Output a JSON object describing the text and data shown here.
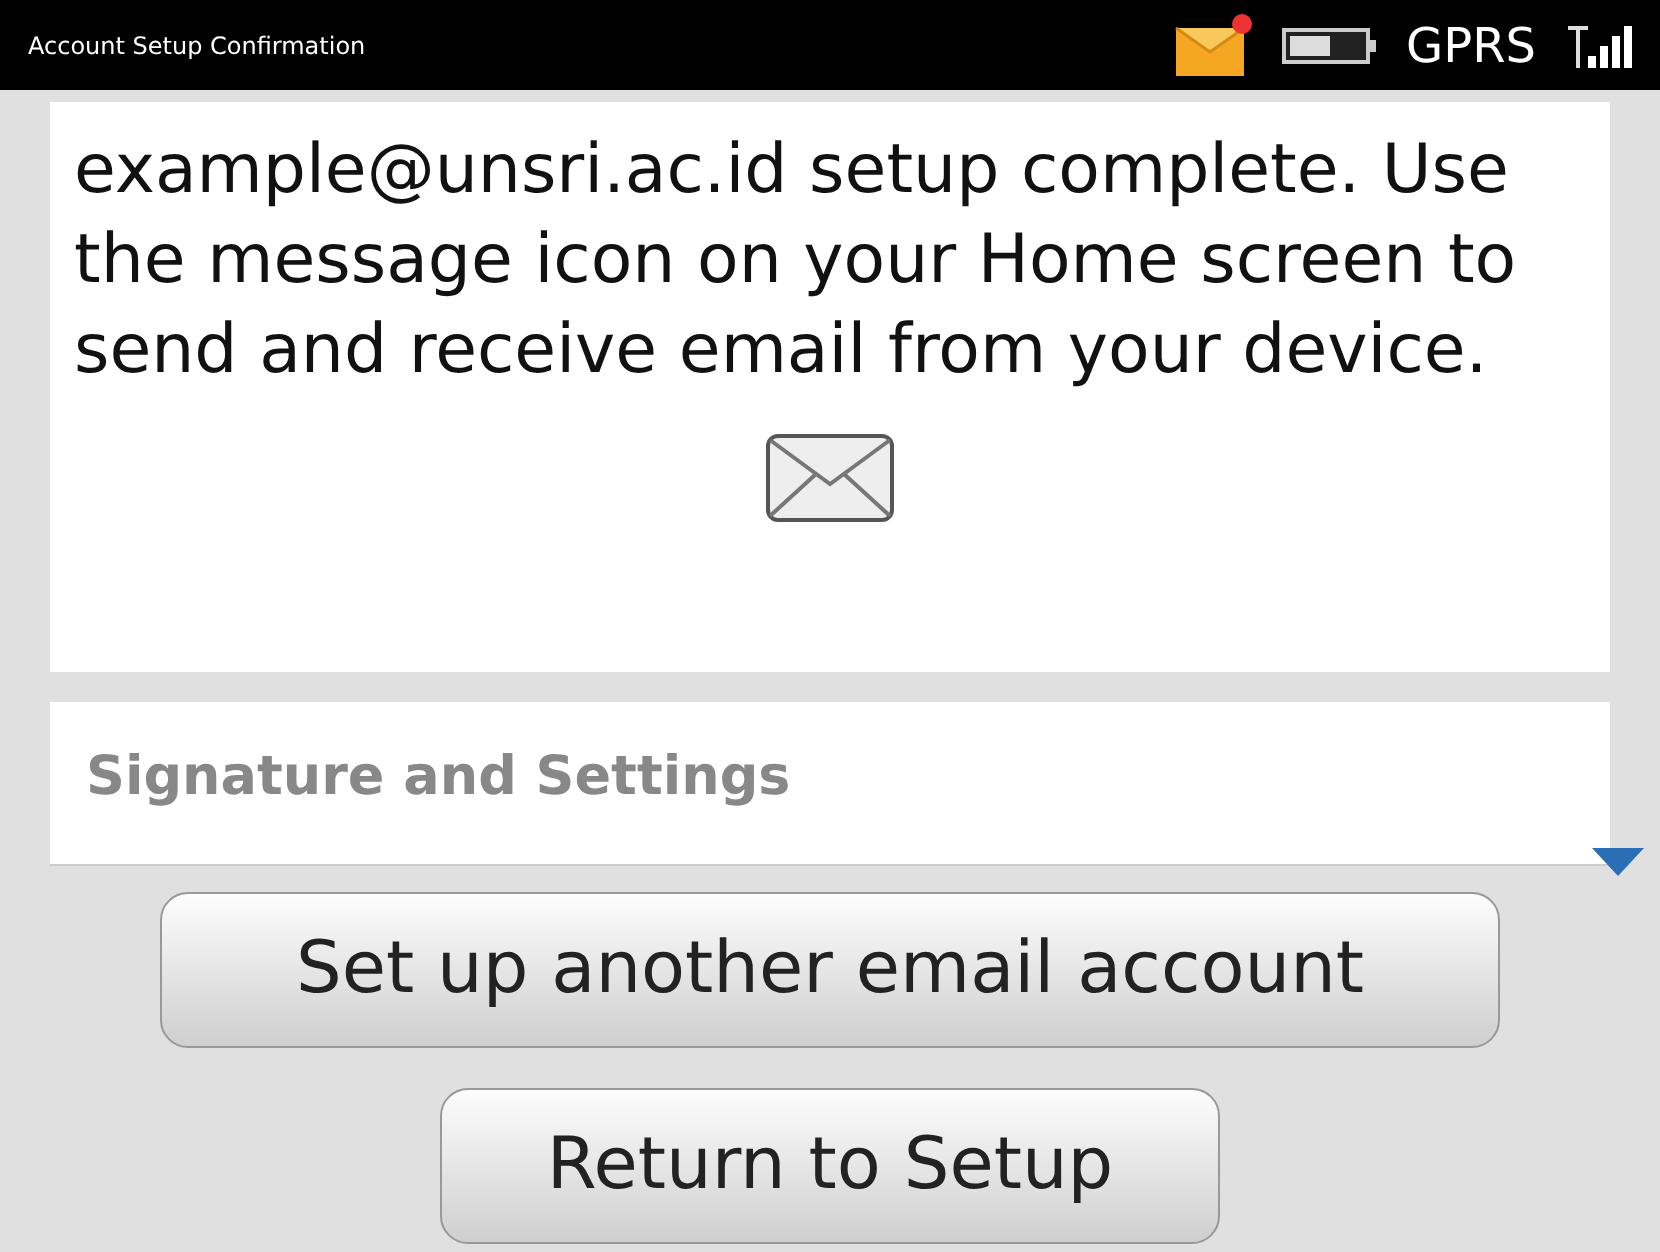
{
  "status_bar": {
    "title": "Account Setup Confirmation",
    "network": "GPRS",
    "new_message": true
  },
  "message": {
    "text": "example@unsri.ac.id setup complete. Use the message icon on your Home screen to send and receive email from your device."
  },
  "section": {
    "title": "Signature and Settings"
  },
  "buttons": [
    {
      "label": "Set up another email account"
    },
    {
      "label": "Return to Setup"
    }
  ]
}
